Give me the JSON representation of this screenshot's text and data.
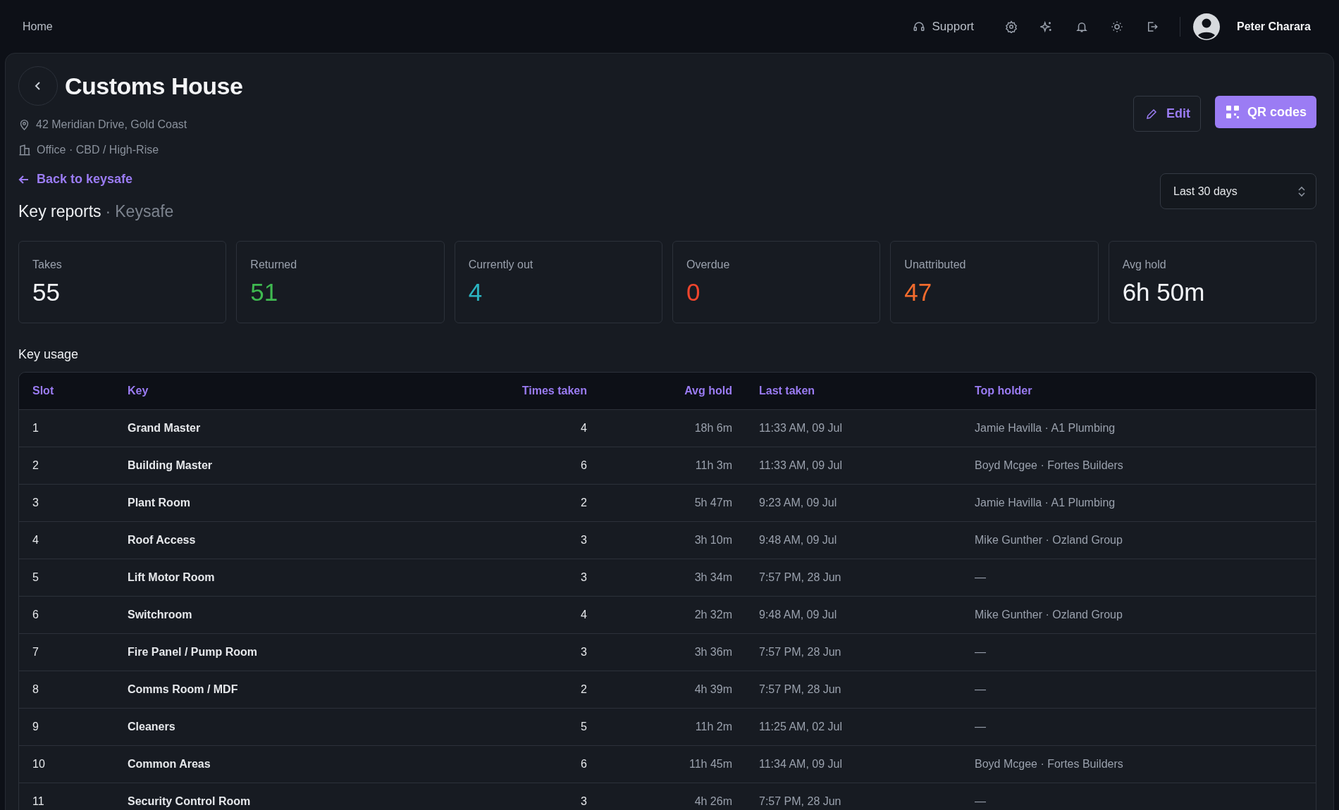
{
  "topbar": {
    "home": "Home",
    "support": "Support",
    "user": "Peter Charara"
  },
  "header": {
    "title": "Customs House",
    "address": "42 Meridian Drive, Gold Coast",
    "category": "Office · CBD / High-Rise",
    "back_link": "Back to keysafe",
    "edit": "Edit",
    "qr": "QR codes"
  },
  "report": {
    "title": "Key reports",
    "separator": "·",
    "subtitle": "Keysafe",
    "range": "Last 30 days"
  },
  "stats": [
    {
      "label": "Takes",
      "value": "55",
      "color": "#f2f4f7"
    },
    {
      "label": "Returned",
      "value": "51",
      "color": "#3fb950"
    },
    {
      "label": "Currently out",
      "value": "4",
      "color": "#2bb3c0"
    },
    {
      "label": "Overdue",
      "value": "0",
      "color": "#f0452d"
    },
    {
      "label": "Unattributed",
      "value": "47",
      "color": "#f26b2d"
    },
    {
      "label": "Avg hold",
      "value": "6h 50m",
      "color": "#f2f4f7"
    }
  ],
  "table": {
    "title": "Key usage",
    "columns": [
      "Slot",
      "Key",
      "Times taken",
      "Avg hold",
      "Last taken",
      "Top holder"
    ],
    "rows": [
      [
        "1",
        "Grand Master",
        "4",
        "18h 6m",
        "11:33 AM, 09 Jul",
        "Jamie Havilla · A1 Plumbing"
      ],
      [
        "2",
        "Building Master",
        "6",
        "11h 3m",
        "11:33 AM, 09 Jul",
        "Boyd Mcgee · Fortes Builders"
      ],
      [
        "3",
        "Plant Room",
        "2",
        "5h 47m",
        "9:23 AM, 09 Jul",
        "Jamie Havilla · A1 Plumbing"
      ],
      [
        "4",
        "Roof Access",
        "3",
        "3h 10m",
        "9:48 AM, 09 Jul",
        "Mike Gunther · Ozland Group"
      ],
      [
        "5",
        "Lift Motor Room",
        "3",
        "3h 34m",
        "7:57 PM, 28 Jun",
        "—"
      ],
      [
        "6",
        "Switchroom",
        "4",
        "2h 32m",
        "9:48 AM, 09 Jul",
        "Mike Gunther · Ozland Group"
      ],
      [
        "7",
        "Fire Panel / Pump Room",
        "3",
        "3h 36m",
        "7:57 PM, 28 Jun",
        "—"
      ],
      [
        "8",
        "Comms Room / MDF",
        "2",
        "4h 39m",
        "7:57 PM, 28 Jun",
        "—"
      ],
      [
        "9",
        "Cleaners",
        "5",
        "11h 2m",
        "11:25 AM, 02 Jul",
        "—"
      ],
      [
        "10",
        "Common Areas",
        "6",
        "11h 45m",
        "11:34 AM, 09 Jul",
        "Boyd Mcgee · Fortes Builders"
      ],
      [
        "11",
        "Security Control Room",
        "3",
        "4h 26m",
        "7:57 PM, 28 Jun",
        "—"
      ]
    ]
  }
}
